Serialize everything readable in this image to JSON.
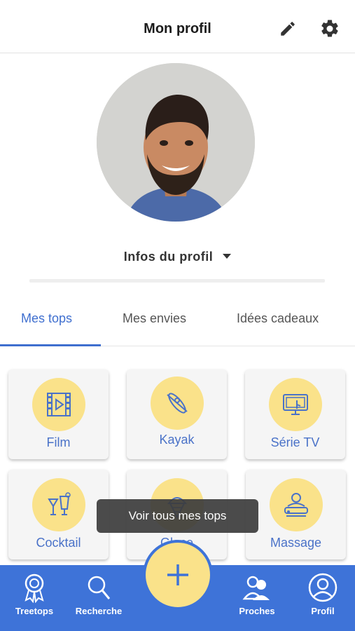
{
  "header": {
    "title": "Mon profil",
    "edit_icon": "pencil-icon",
    "settings_icon": "gear-icon"
  },
  "profile": {
    "infos_label": "Infos du profil"
  },
  "tabs": [
    {
      "label": "Mes tops",
      "active": true
    },
    {
      "label": "Mes envies",
      "active": false
    },
    {
      "label": "Idées cadeaux",
      "active": false
    }
  ],
  "tops": [
    {
      "label": "Film",
      "icon": "film-icon"
    },
    {
      "label": "Kayak",
      "icon": "kayak-icon"
    },
    {
      "label": "Série TV",
      "icon": "tv-series-icon"
    },
    {
      "label": "Cocktail",
      "icon": "cocktail-icon"
    },
    {
      "label": "Glace",
      "icon": "ice-cream-icon"
    },
    {
      "label": "Massage",
      "icon": "massage-icon"
    }
  ],
  "toast": {
    "text": "Voir tous mes tops"
  },
  "bottom_nav": [
    {
      "label": "Treetops",
      "icon": "award-ribbon-icon"
    },
    {
      "label": "Recherche",
      "icon": "search-icon"
    },
    {
      "label": "Proches",
      "icon": "people-icon"
    },
    {
      "label": "Profil",
      "icon": "user-circle-icon"
    }
  ],
  "fab": {
    "icon": "plus-icon"
  },
  "colors": {
    "accent": "#3e73d8",
    "tab_active": "#3f6fcf",
    "highlight": "#fae28a"
  }
}
